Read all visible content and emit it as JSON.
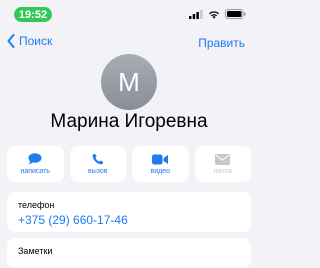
{
  "status_bar": {
    "time": "19:52",
    "time_pill_color": "#34c759",
    "icons": [
      "signal-icon",
      "wifi-icon",
      "battery-icon"
    ]
  },
  "nav": {
    "back_label": "Поиск",
    "edit_label": "Править"
  },
  "contact": {
    "initial": "М",
    "name": "Марина Игоревна"
  },
  "actions": [
    {
      "label": "написать",
      "icon": "message-icon",
      "enabled": true
    },
    {
      "label": "вызов",
      "icon": "phone-icon",
      "enabled": true
    },
    {
      "label": "видео",
      "icon": "video-icon",
      "enabled": true
    },
    {
      "label": "почта",
      "icon": "mail-icon",
      "enabled": false
    }
  ],
  "phone": {
    "label": "телефон",
    "number": "+375 (29) 660-17-46"
  },
  "notes": {
    "label": "Заметки"
  },
  "colors": {
    "accent": "#1f7bf0",
    "background": "#f2f2f7",
    "card": "#ffffff",
    "disabled": "#c7c7cc"
  }
}
